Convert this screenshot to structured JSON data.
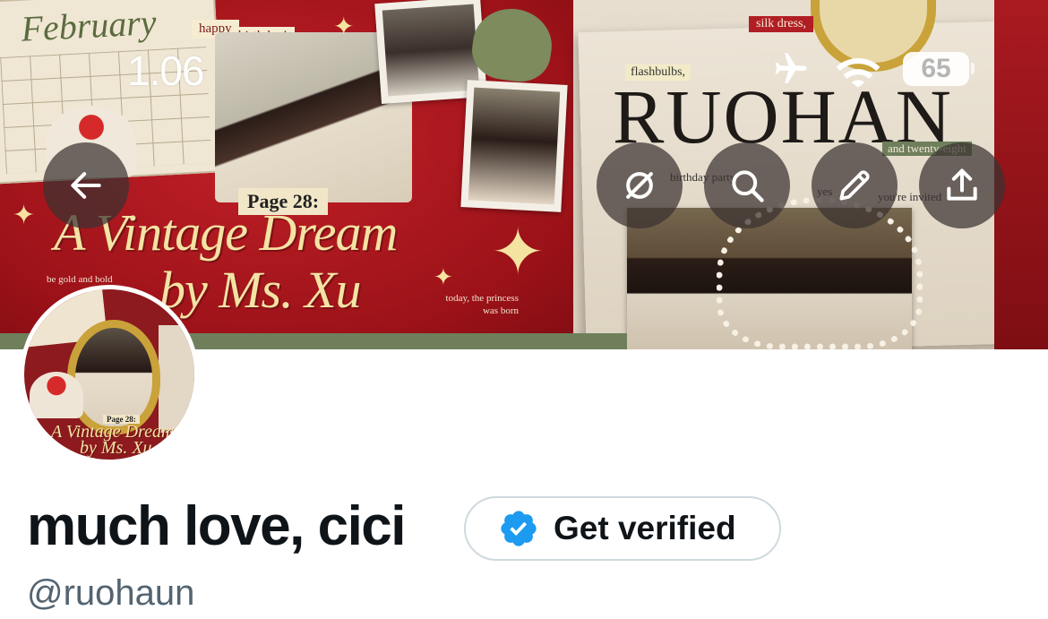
{
  "status_bar": {
    "time": "1.06",
    "battery": "65",
    "icons": [
      "airplane-icon",
      "wifi-icon",
      "battery-icon"
    ]
  },
  "banner": {
    "calendar_month": "February",
    "happy_tag": "happy",
    "birthday_tag": "birthday!",
    "page_label": "Page 28:",
    "title_line1": "A Vintage Dream",
    "title_line2": "by Ms. Xu",
    "small_left": "be gold and bold",
    "small_right": "today, the princess was born",
    "flashbulbs_tag": "flashbulbs,",
    "silk_tag": "silk dress,",
    "magazine_title": "RUOHAN",
    "twenty_tag": "and twenty-eight",
    "party_text": "birthday party",
    "yes_text": "yes",
    "invited_text": "you're invited"
  },
  "nav": {
    "back_icon": "arrow-left-icon",
    "actions": [
      "no-retweets-icon",
      "search-icon",
      "edit-icon",
      "share-icon"
    ]
  },
  "avatar": {
    "page_label": "Page 28:",
    "title_line1": "A Vintage Dream",
    "title_line2": "by Ms. Xu"
  },
  "profile": {
    "display_name": "much love, cici",
    "handle": "@ruohaun",
    "verify_label": "Get verified"
  },
  "colors": {
    "verified_blue": "#1d9bf0",
    "name_text": "#0f1419",
    "handle_text": "#536471",
    "button_border": "#cfd9de"
  }
}
